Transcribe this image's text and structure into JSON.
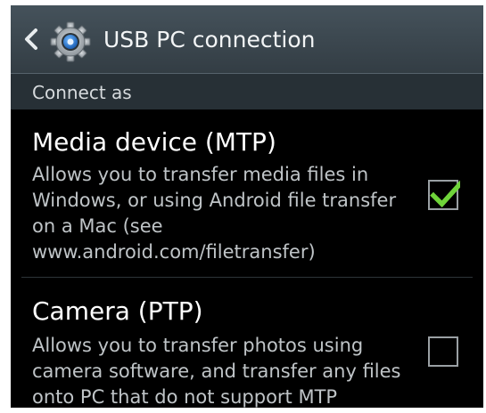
{
  "header": {
    "title": "USB PC connection",
    "back_icon": "chevron-left-icon",
    "app_icon": "gear-icon"
  },
  "section": {
    "label": "Connect as"
  },
  "options": [
    {
      "title": "Media device (MTP)",
      "description": "Allows you to transfer media files in Windows, or using Android file transfer on a Mac (see www.android.com/filetransfer)",
      "checked": true
    },
    {
      "title": "Camera (PTP)",
      "description": "Allows you to transfer photos using camera software, and transfer any files onto PC that do not support MTP",
      "checked": false
    }
  ],
  "colors": {
    "accent": "#6fd43a",
    "header_bg": "#3d4850",
    "section_bg": "#273036",
    "background": "#000000"
  }
}
